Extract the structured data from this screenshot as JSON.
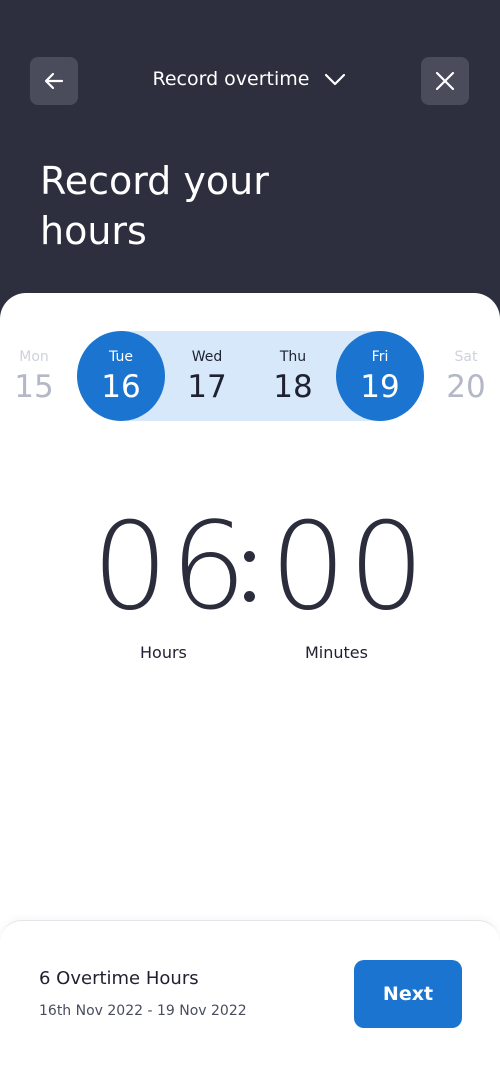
{
  "header": {
    "title": "Record overtime",
    "headline": "Record your hours",
    "back_icon": "arrow-left-icon",
    "close_icon": "close-icon",
    "dropdown_icon": "chevron-down-icon"
  },
  "days": [
    {
      "name": "Mon",
      "num": "15",
      "state": "faded"
    },
    {
      "name": "Tue",
      "num": "16",
      "state": "selected"
    },
    {
      "name": "Wed",
      "num": "17",
      "state": "in-range"
    },
    {
      "name": "Thu",
      "num": "18",
      "state": "in-range"
    },
    {
      "name": "Fri",
      "num": "19",
      "state": "selected"
    },
    {
      "name": "Sat",
      "num": "20",
      "state": "faded"
    }
  ],
  "time": {
    "hours": "06",
    "minutes": "00",
    "hours_label": "Hours",
    "minutes_label": "Minutes"
  },
  "summary": {
    "title": "6 Overtime Hours",
    "range": "16th Nov 2022 - 19 Nov 2022",
    "next_label": "Next"
  },
  "colors": {
    "header_bg": "#2d2f3e",
    "accent": "#1b75d0",
    "range_bg": "#d6e8f9"
  }
}
